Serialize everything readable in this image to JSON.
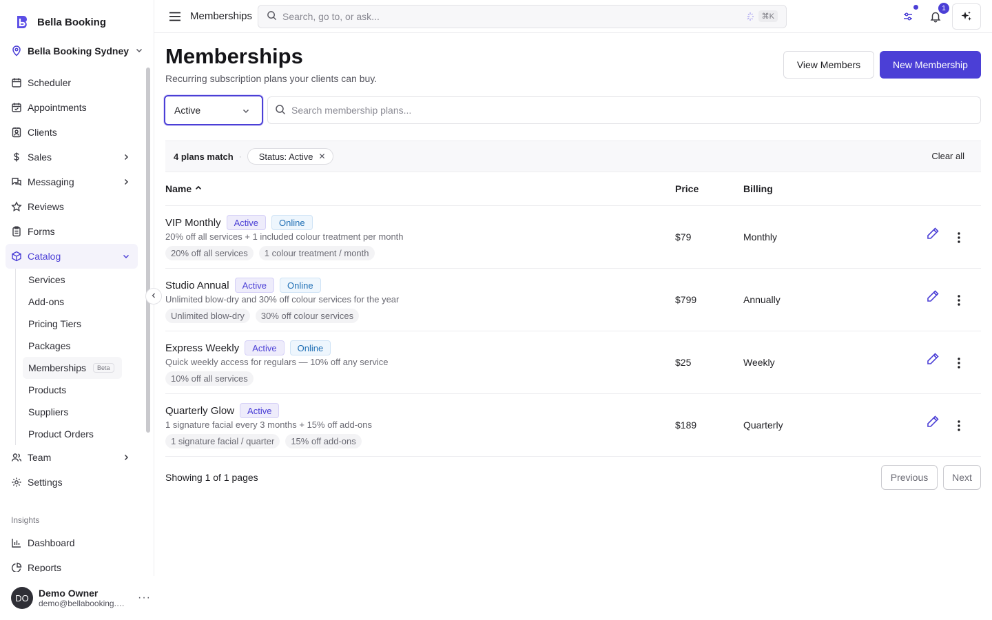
{
  "app": {
    "name": "Bella Booking",
    "location": "Bella Booking Sydney",
    "brand_color": "#4b3fd6"
  },
  "sidebar": {
    "items": [
      {
        "label": "Scheduler",
        "icon": "calendar-icon"
      },
      {
        "label": "Appointments",
        "icon": "calendar-check-icon"
      },
      {
        "label": "Clients",
        "icon": "contact-icon"
      },
      {
        "label": "Sales",
        "icon": "dollar-icon"
      },
      {
        "label": "Messaging",
        "icon": "chat-icon"
      },
      {
        "label": "Reviews",
        "icon": "star-icon"
      },
      {
        "label": "Forms",
        "icon": "clipboard-icon"
      },
      {
        "label": "Catalog",
        "icon": "cube-icon"
      }
    ],
    "catalog_sub": [
      {
        "label": "Services"
      },
      {
        "label": "Add-ons"
      },
      {
        "label": "Pricing Tiers"
      },
      {
        "label": "Packages"
      },
      {
        "label": "Memberships",
        "badge": "Beta"
      },
      {
        "label": "Products"
      },
      {
        "label": "Suppliers"
      },
      {
        "label": "Product Orders"
      }
    ],
    "after_items": [
      {
        "label": "Team",
        "icon": "users-icon"
      },
      {
        "label": "Settings",
        "icon": "gear-icon"
      }
    ],
    "insights_label": "Insights",
    "insights_items": [
      {
        "label": "Dashboard",
        "icon": "bar-chart-icon"
      },
      {
        "label": "Reports",
        "icon": "pie-chart-icon"
      }
    ]
  },
  "user": {
    "initials": "DO",
    "name": "Demo Owner",
    "email": "demo@bellabooking.com.au",
    "more": "···"
  },
  "topbar": {
    "title": "Memberships",
    "search_placeholder": "Search, go to, or ask...",
    "shortcut": "⌘K",
    "notification_count": "1"
  },
  "page": {
    "title": "Memberships",
    "subtitle": "Recurring subscription plans your clients can buy.",
    "view_members_label": "View Members",
    "new_membership_label": "New Membership"
  },
  "filters": {
    "status_value": "Active",
    "search_placeholder": "Search membership plans...",
    "match_count": "4 plans match",
    "separator": "·",
    "chip_label": "Status: Active",
    "chip_close": "✕",
    "clear_all": "Clear all"
  },
  "table": {
    "columns": {
      "name": "Name",
      "price": "Price",
      "billing": "Billing"
    },
    "sort": {
      "column": "name",
      "direction": "asc"
    },
    "rows": [
      {
        "name": "VIP Monthly",
        "status": "Active",
        "online": "Online",
        "description": "20% off all services + 1 included colour treatment per month",
        "tags": [
          "20% off all services",
          "1 colour treatment / month"
        ],
        "price": "$79",
        "billing": "Monthly"
      },
      {
        "name": "Studio Annual",
        "status": "Active",
        "online": "Online",
        "description": "Unlimited blow-dry and 30% off colour services for the year",
        "tags": [
          "Unlimited blow-dry",
          "30% off colour services"
        ],
        "price": "$799",
        "billing": "Annually"
      },
      {
        "name": "Express Weekly",
        "status": "Active",
        "online": "Online",
        "description": "Quick weekly access for regulars — 10% off any service",
        "tags": [
          "10% off all services"
        ],
        "price": "$25",
        "billing": "Weekly"
      },
      {
        "name": "Quarterly Glow",
        "status": "Active",
        "online": null,
        "description": "1 signature facial every 3 months + 15% off add-ons",
        "tags": [
          "1 signature facial / quarter",
          "15% off add-ons"
        ],
        "price": "$189",
        "billing": "Quarterly"
      }
    ]
  },
  "pagination": {
    "text": "Showing 1 of 1 pages",
    "previous": "Previous",
    "next": "Next"
  }
}
